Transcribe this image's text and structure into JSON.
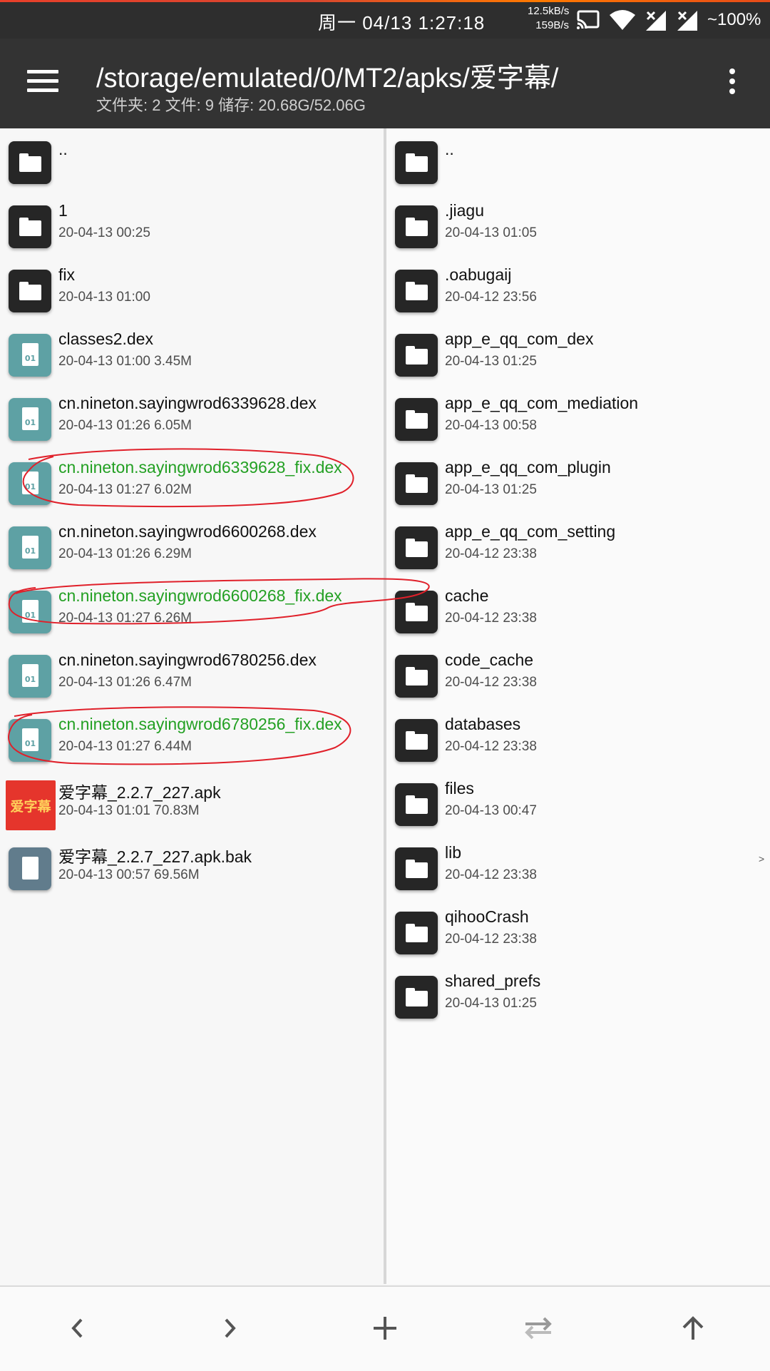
{
  "status_bar": {
    "time": "周一 04/13  1:27:18",
    "speed_up": "12.5kB/s",
    "speed_down": "159B/s",
    "battery": "~100%"
  },
  "toolbar": {
    "path": "/storage/emulated/0/MT2/apks/爱字幕/",
    "summary": "文件夹: 2  文件: 9  储存: 20.68G/52.06G"
  },
  "left_pane": {
    "items": [
      {
        "name": "..",
        "meta": "",
        "type": "folder"
      },
      {
        "name": "1",
        "meta": "20-04-13 00:25",
        "type": "folder"
      },
      {
        "name": "fix",
        "meta": "20-04-13 01:00",
        "type": "folder"
      },
      {
        "name": "classes2.dex",
        "meta": "20-04-13 01:00  3.45M",
        "type": "dex"
      },
      {
        "name": "cn.nineton.sayingwrod6339628.dex",
        "meta": "20-04-13 01:26  6.05M",
        "type": "dex"
      },
      {
        "name": "cn.nineton.sayingwrod6339628_fix.dex",
        "meta": "20-04-13 01:27  6.02M",
        "type": "dex",
        "highlight": true
      },
      {
        "name": "cn.nineton.sayingwrod6600268.dex",
        "meta": "20-04-13 01:26  6.29M",
        "type": "dex"
      },
      {
        "name": "cn.nineton.sayingwrod6600268_fix.dex",
        "meta": "20-04-13 01:27  6.26M",
        "type": "dex",
        "highlight": true
      },
      {
        "name": "cn.nineton.sayingwrod6780256.dex",
        "meta": "20-04-13 01:26  6.47M",
        "type": "dex"
      },
      {
        "name": "cn.nineton.sayingwrod6780256_fix.dex",
        "meta": "20-04-13 01:27  6.44M",
        "type": "dex",
        "highlight": true
      },
      {
        "name": "爱字幕_2.2.7_227.apk",
        "meta": "20-04-13 01:01  70.83M",
        "type": "apk",
        "icon_text": "爱字幕"
      },
      {
        "name": "爱字幕_2.2.7_227.apk.bak",
        "meta": "20-04-13 00:57  69.56M",
        "type": "bak"
      }
    ]
  },
  "right_pane": {
    "items": [
      {
        "name": "..",
        "meta": ""
      },
      {
        "name": ".jiagu",
        "meta": "20-04-13 01:05"
      },
      {
        "name": ".oabugaij",
        "meta": "20-04-12 23:56"
      },
      {
        "name": "app_e_qq_com_dex",
        "meta": "20-04-13 01:25"
      },
      {
        "name": "app_e_qq_com_mediation",
        "meta": "20-04-13 00:58"
      },
      {
        "name": "app_e_qq_com_plugin",
        "meta": "20-04-13 01:25"
      },
      {
        "name": "app_e_qq_com_setting",
        "meta": "20-04-12 23:38"
      },
      {
        "name": "cache",
        "meta": "20-04-12 23:38"
      },
      {
        "name": "code_cache",
        "meta": "20-04-12 23:38"
      },
      {
        "name": "databases",
        "meta": "20-04-12 23:38"
      },
      {
        "name": "files",
        "meta": "20-04-13 00:47"
      },
      {
        "name": "lib",
        "meta": "20-04-12 23:38"
      },
      {
        "name": "qihooCrash",
        "meta": "20-04-12 23:38"
      },
      {
        "name": "shared_prefs",
        "meta": "20-04-13 01:25"
      }
    ]
  },
  "side_marker": ">",
  "colors": {
    "toolbar": "#333333",
    "folder_icon": "#262626",
    "dex_icon": "#5ea1a4",
    "highlight_text": "#23a023",
    "annotation": "#e0202a"
  }
}
